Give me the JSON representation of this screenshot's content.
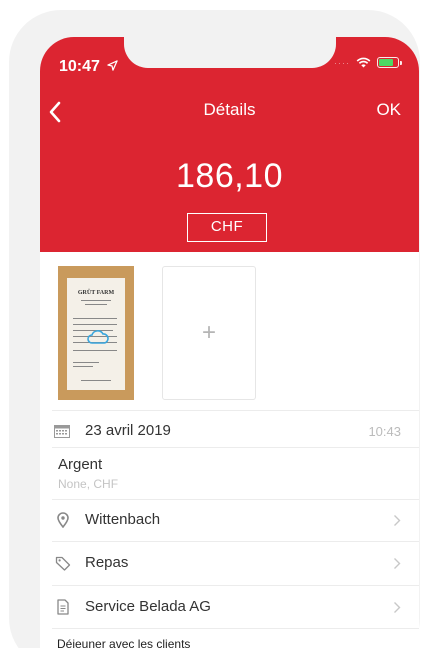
{
  "status_bar": {
    "time": "10:47",
    "signal_dots": "····"
  },
  "nav": {
    "title": "Détails",
    "ok_label": "OK"
  },
  "amount": {
    "value": "186,10",
    "currency": "CHF"
  },
  "receipt": {
    "merchant": "GRÜT FARM"
  },
  "add_photo": {
    "symbol": "+"
  },
  "date_row": {
    "date": "23 avril 2019",
    "time": "10:43"
  },
  "payment": {
    "label": "Argent",
    "sub": "None, CHF"
  },
  "rows": [
    {
      "icon": "location-pin-icon",
      "label": "Wittenbach"
    },
    {
      "icon": "tag-icon",
      "label": "Repas"
    },
    {
      "icon": "document-icon",
      "label": "Service Belada AG"
    }
  ],
  "note": "Déjeuner avec les clients",
  "colors": {
    "accent": "#dc2531",
    "background": "#ffffff",
    "frame": "#f2f2f2"
  }
}
